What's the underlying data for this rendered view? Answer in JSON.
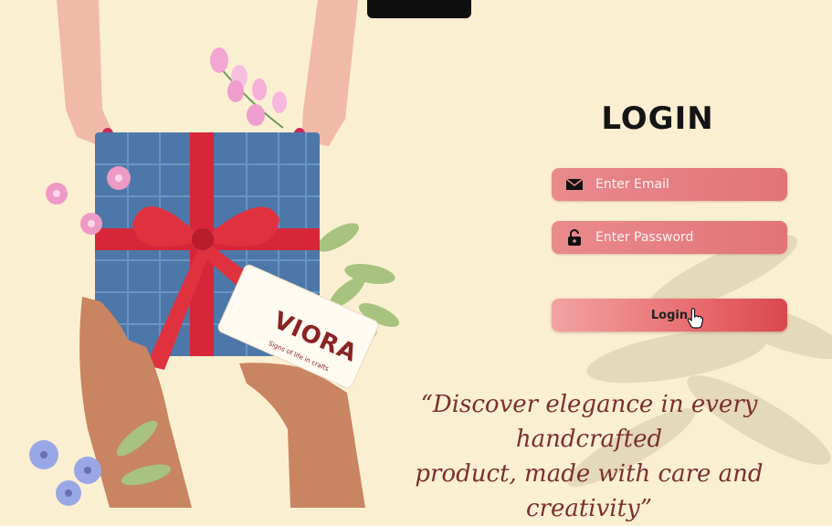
{
  "login": {
    "title": "LOGIN",
    "email_placeholder": "Enter Email",
    "password_placeholder": "Enter Password",
    "button_label": "Login"
  },
  "brand": {
    "name": "VIORA",
    "tagline": "Signs of life in crafts"
  },
  "quote": {
    "line1": "“Discover elegance in every handcrafted",
    "line2": "product, made with care and creativity”"
  },
  "colors": {
    "background": "#fbefd2",
    "field": "#e27478",
    "quote": "#7a2f30",
    "gift_box": "#4d77a8",
    "ribbon": "#d7263a"
  },
  "icons": {
    "email": "envelope-icon",
    "password": "lock-icon",
    "cursor": "hand-pointer-icon"
  }
}
